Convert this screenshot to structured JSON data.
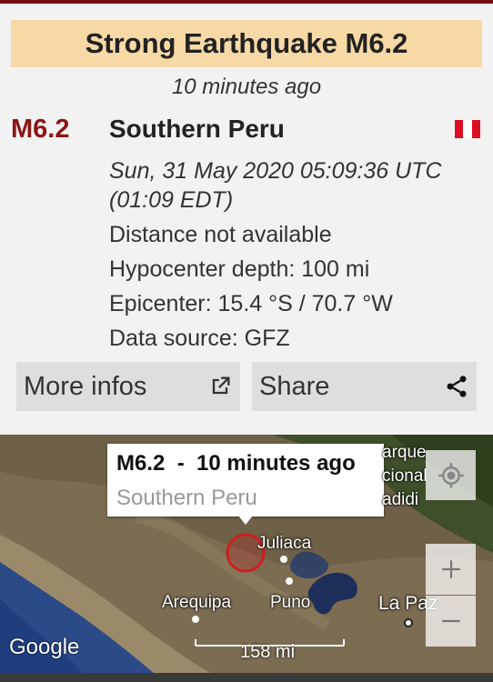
{
  "alert": {
    "banner_title": "Strong Earthquake M6.2",
    "time_ago": "10 minutes ago",
    "magnitude": "M6.2",
    "region": "Southern Peru",
    "flag": "peru-flag"
  },
  "details": {
    "datetime": "Sun, 31 May 2020 05:09:36 UTC",
    "local_time": "(01:09 EDT)",
    "distance": "Distance not available",
    "depth": "Hypocenter depth: 100 mi",
    "epicenter": "Epicenter: 15.4 °S / 70.7 °W",
    "source": "Data source: GFZ"
  },
  "actions": {
    "more_label": "More infos",
    "more_icon": "open-in-new-icon",
    "share_label": "Share",
    "share_icon": "share-icon"
  },
  "map": {
    "popup_title": "M6.2  -  10 minutes ago",
    "popup_subtitle": "Southern Peru",
    "labels": {
      "julica": "Juliaca",
      "arequipa": "Arequipa",
      "puno": "Puno",
      "lapaz": "La Paz",
      "park_1": "arque",
      "park_2": "cional",
      "park_3": "adidi"
    },
    "attribution": "Google",
    "scale": "158 mi",
    "epicenter_marker_color": "#cc1f1f"
  },
  "colors": {
    "banner": "#f7d9a6",
    "magnitude": "#8b1515",
    "topbar": "#7a1010"
  }
}
